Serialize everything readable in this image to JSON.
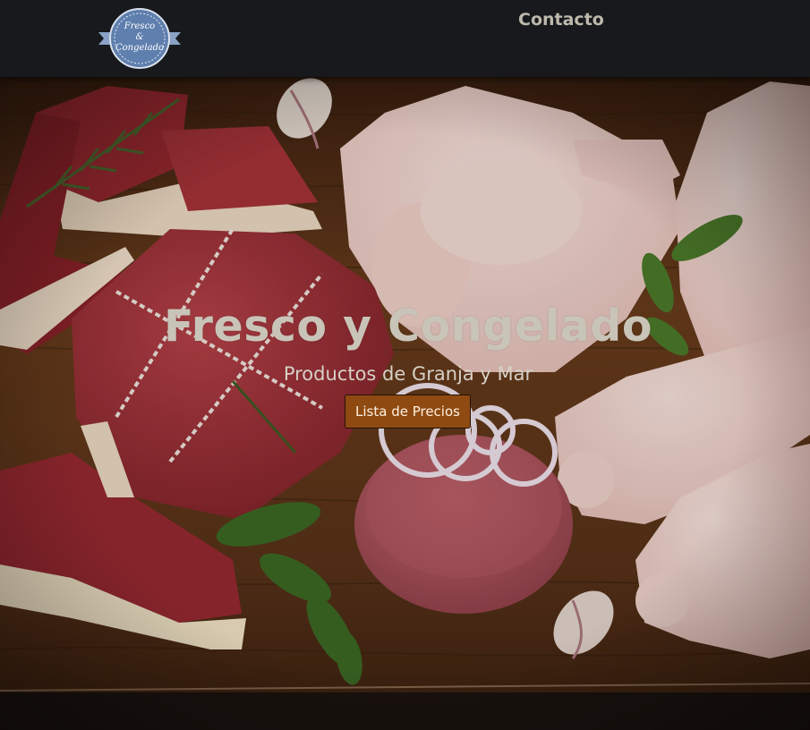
{
  "nav": {
    "logo_line1": "Fresco",
    "logo_line2": "&",
    "logo_line3": "Congelado",
    "contact_label": "Contacto"
  },
  "hero": {
    "title": "Fresco y Congelado",
    "subtitle": "Productos de Granja y Mar",
    "button_label": "Lista de Precios"
  },
  "colors": {
    "navbar": "#17191c",
    "board": "#5a3319",
    "button": "#8f4a12",
    "logo_badge": "#5f7fae"
  }
}
